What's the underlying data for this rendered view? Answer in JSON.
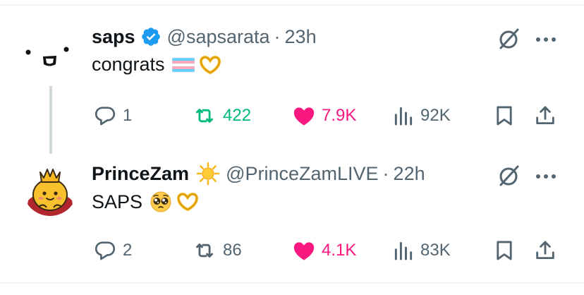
{
  "tweets": [
    {
      "name": "saps",
      "handle": "@sapsarata",
      "time": "23h",
      "text": "congrats",
      "replies": "1",
      "reposts": "422",
      "likes": "7.9K",
      "views": "92K",
      "reposted": true,
      "liked": true,
      "verified": true
    },
    {
      "name": "PrinceZam",
      "handle": "@PrinceZamLIVE",
      "time": "22h",
      "text": "SAPS",
      "replies": "2",
      "reposts": "86",
      "likes": "4.1K",
      "views": "83K",
      "reposted": false,
      "liked": true,
      "verified": false
    }
  ],
  "separator": "·",
  "colors": {
    "text": "#0f1419",
    "muted": "#536471",
    "verified": "#1d9bf0",
    "repost": "#00ba7c",
    "like": "#f91880",
    "thread_line": "#cfd9de"
  },
  "icons": [
    "verified-badge-icon",
    "trans-flag-emoji",
    "heart-hands-emoji",
    "sun-emoji",
    "pleading-face-emoji",
    "grok-icon",
    "more-icon",
    "reply-icon",
    "repost-icon",
    "like-icon",
    "views-icon",
    "bookmark-icon",
    "share-icon"
  ]
}
